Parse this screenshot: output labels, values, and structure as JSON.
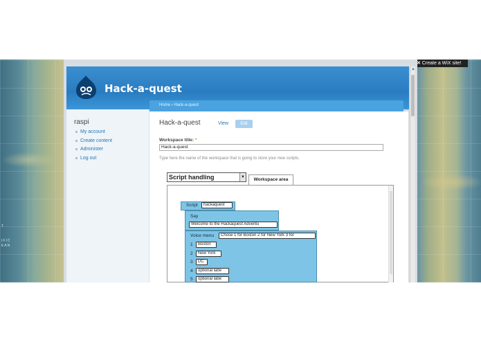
{
  "wix_badge": {
    "icon": "x-logo-icon",
    "label": "Create a WiX site!"
  },
  "map": {
    "ocean_label": "...",
    "labels": [
      "T",
      "IFIC",
      "EAN"
    ]
  },
  "site": {
    "name": "Hack-a-quest",
    "breadcrumb": "Home › Hack-a-quest"
  },
  "sidebar": {
    "user": "raspi",
    "items": [
      {
        "label": "My account"
      },
      {
        "label": "Create content"
      },
      {
        "label": "Administer"
      },
      {
        "label": "Log out"
      }
    ]
  },
  "page": {
    "title": "Hack-a-quest",
    "tabs": {
      "view": "View",
      "edit": "Edit"
    },
    "field_label": "Workspace title:",
    "required_mark": "*",
    "field_value": "Hack-a-quest",
    "field_help": "Type here the name of the workspace that is going to store your new scripts."
  },
  "editor": {
    "category_select": "Script handling",
    "workspace_tab": "Workspace area",
    "script_label": "Script",
    "script_name": "hackaquest",
    "say_label": "Say",
    "say_text": "Welcome to the Hackaquest Adventu",
    "voice_menu_label": "Voice menu",
    "voice_menu_prompt": "Chose 1 for Boston 2 for New York 3 for",
    "options": [
      {
        "num": "1",
        "value": "Boston"
      },
      {
        "num": "2",
        "value": "New York"
      },
      {
        "num": "3",
        "value": "DC"
      },
      {
        "num": "4",
        "value": "optional labe"
      },
      {
        "num": "5",
        "value": "optional labe"
      }
    ]
  },
  "colors": {
    "header_blue": "#2a7cc0",
    "block_blue": "#7dc4e6",
    "link_blue": "#2874b2"
  }
}
